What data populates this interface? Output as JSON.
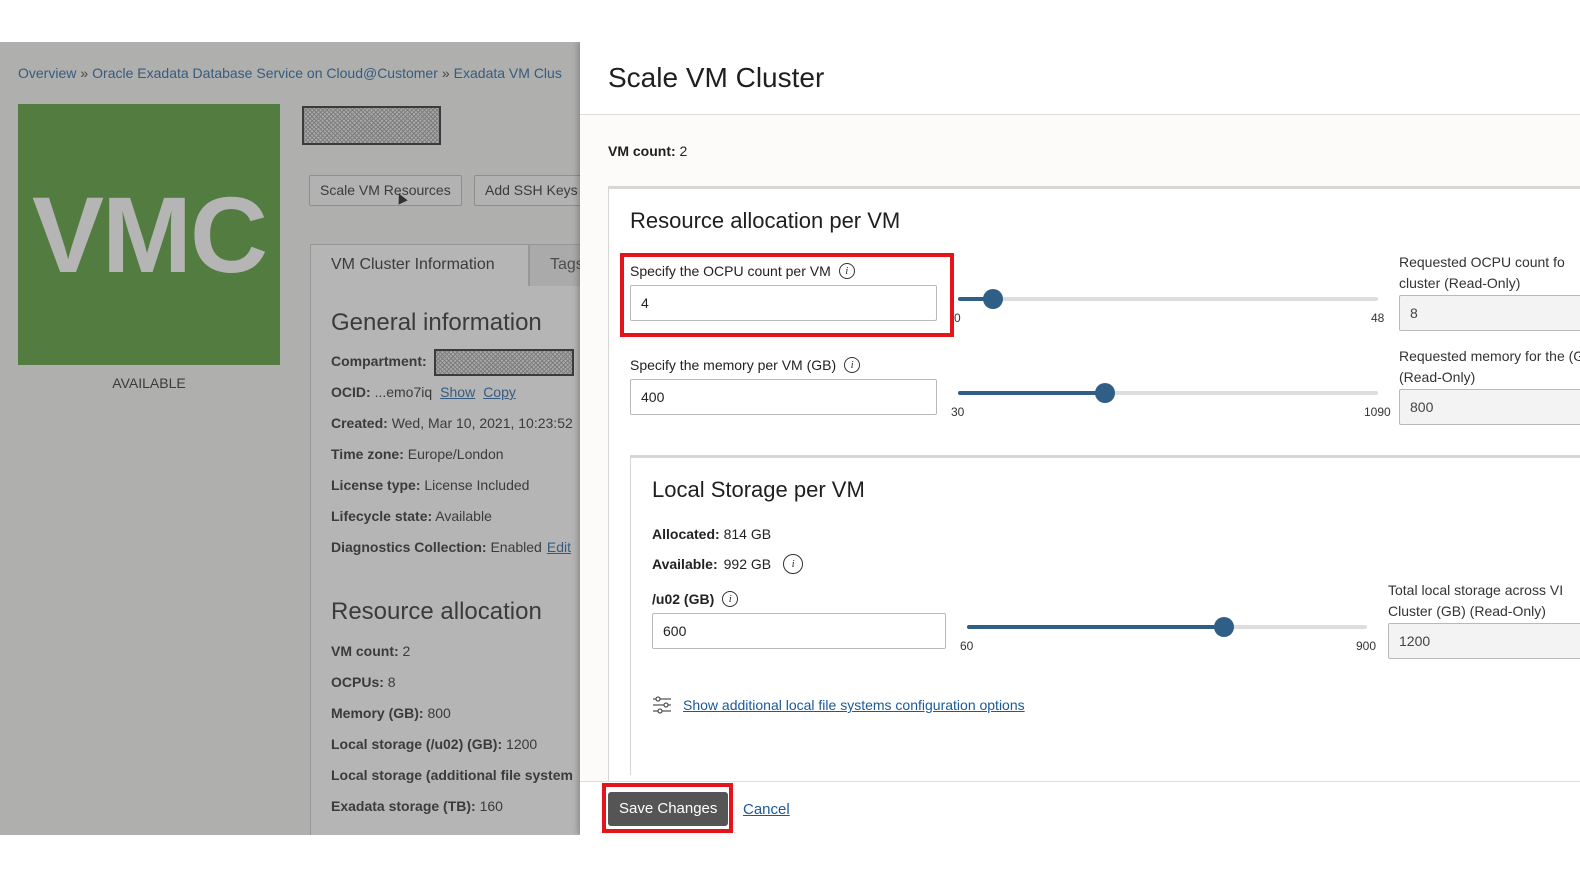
{
  "breadcrumb": {
    "items": [
      "Overview",
      "Oracle Exadata Database Service on Cloud@Customer",
      "Exadata VM Clus"
    ],
    "separator": "»"
  },
  "resource_tile": {
    "text": "VMC",
    "status": "AVAILABLE",
    "color": "#4e9a2b"
  },
  "actions": {
    "scale": "Scale VM Resources",
    "add_ssh": "Add SSH Keys"
  },
  "tabs": {
    "info": "VM Cluster Information",
    "tags": "Tags"
  },
  "general": {
    "title": "General information",
    "compartment_label": "Compartment:",
    "ocid_label": "OCID:",
    "ocid_value": "...emo7iq",
    "ocid_show": "Show",
    "ocid_copy": "Copy",
    "created_label": "Created:",
    "created_value": "Wed, Mar 10, 2021, 10:23:52",
    "timezone_label": "Time zone:",
    "timezone_value": "Europe/London",
    "license_label": "License type:",
    "license_value": "License Included",
    "lifecycle_label": "Lifecycle state:",
    "lifecycle_value": "Available",
    "diag_label": "Diagnostics Collection:",
    "diag_value": "Enabled",
    "diag_edit": "Edit"
  },
  "resources": {
    "title": "Resource allocation",
    "vm_count_label": "VM count:",
    "vm_count_value": "2",
    "ocpus_label": "OCPUs:",
    "ocpus_value": "8",
    "memory_label": "Memory (GB):",
    "memory_value": "800",
    "local_label": "Local storage (/u02) (GB):",
    "local_value": "1200",
    "local_add_label": "Local storage (additional file system",
    "exadata_label": "Exadata storage (TB):",
    "exadata_value": "160"
  },
  "drawer": {
    "title": "Scale VM Cluster",
    "vm_count_label": "VM count:",
    "vm_count_value": "2",
    "alloc_title": "Resource allocation per VM",
    "ocpu": {
      "label": "Specify the OCPU count per VM",
      "value": "4",
      "min": "0",
      "max": "48",
      "fraction": 0.083,
      "ro_label": "Requested OCPU count fo cluster (Read-Only)",
      "ro_value": "8"
    },
    "memory": {
      "label": "Specify the memory per VM (GB)",
      "value": "400",
      "min": "30",
      "max": "1090",
      "fraction": 0.349,
      "ro_label": "Requested memory for the (GB) (Read-Only)",
      "ro_value": "800"
    },
    "storage": {
      "title": "Local Storage per VM",
      "allocated_label": "Allocated:",
      "allocated_value": "814 GB",
      "available_label": "Available:",
      "available_value": "992 GB",
      "u02_label": "/u02 (GB)",
      "u02_value": "600",
      "min": "60",
      "max": "900",
      "fraction": 0.643,
      "ro_label": "Total local storage across VI Cluster (GB) (Read-Only)",
      "ro_value": "1200",
      "more_link": "Show additional local file systems configuration options"
    },
    "save": "Save Changes",
    "cancel": "Cancel"
  },
  "colors": {
    "accent": "#2f5f86",
    "highlight": "#e5141b",
    "link": "#1a5a99"
  }
}
